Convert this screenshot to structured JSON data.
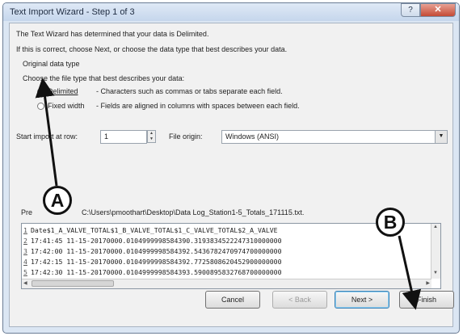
{
  "window": {
    "title": "Text Import Wizard - Step 1 of 3",
    "help_label": "?",
    "close_label": "✕"
  },
  "intro": {
    "line1": "The Text Wizard has determined that your data is Delimited.",
    "line2": "If this is correct, choose Next, or choose the data type that best describes your data."
  },
  "original_data_type": {
    "group_label": "Original data type",
    "prompt": "Choose the file type that best describes your data:",
    "options": [
      {
        "label": "Delimited",
        "description": "- Characters such as commas or tabs separate each field.",
        "selected": true
      },
      {
        "label": "Fixed width",
        "description": "- Fields are aligned in columns with spaces between each field.",
        "selected": false
      }
    ]
  },
  "start_import": {
    "label": "Start import at row:",
    "value": "1"
  },
  "file_origin": {
    "label": "File origin:",
    "value": "Windows (ANSI)"
  },
  "preview": {
    "label_prefix": "Pre",
    "label_path": "C:\\Users\\pmoothart\\Desktop\\Data Log_Station1-5_Totals_171115.txt.",
    "rows": [
      {
        "num": "1",
        "text": "Date$1_A_VALVE_TOTAL$1_B_VALVE_TOTAL$1_C_VALVE_TOTAL$2_A_VALVE"
      },
      {
        "num": "2",
        "text": "17:41:45 11-15-20170000.0104999998584390.3193834522247310000000"
      },
      {
        "num": "3",
        "text": "17:42:00 11-15-20170000.0104999998584392.5436782470974700000000"
      },
      {
        "num": "4",
        "text": "17:42:15 11-15-20170000.0104999998584392.7725808620452900000000"
      },
      {
        "num": "5",
        "text": "17:42:30 11-15-20170000.0104999998584393.5900895832768700000000"
      }
    ]
  },
  "buttons": {
    "cancel": "Cancel",
    "back": "< Back",
    "next": "Next >",
    "finish": "Finish"
  },
  "annotations": {
    "a": "A",
    "b": "B"
  },
  "icons": {
    "help": "help-icon",
    "close": "close-icon",
    "spin_up": "▲",
    "spin_down": "▼",
    "dropdown": "▼",
    "scroll_up": "▲",
    "scroll_down": "▼",
    "scroll_left": "◀",
    "scroll_right": "▶"
  }
}
